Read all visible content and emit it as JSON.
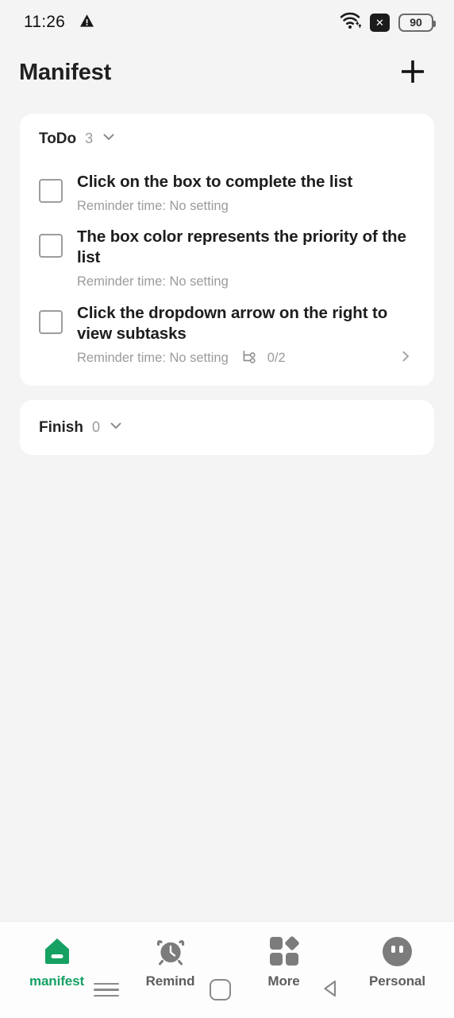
{
  "status_bar": {
    "time": "11:26",
    "warning_icon": "warning-triangle-icon",
    "wifi_icon": "wifi-icon",
    "x_badge_icon": "x-badge-icon",
    "x_badge_label": "✕",
    "battery_level": "90"
  },
  "header": {
    "title": "Manifest",
    "add_icon": "plus-icon"
  },
  "groups": [
    {
      "title": "ToDo",
      "count": "3",
      "chevron_icon": "chevron-down-icon",
      "tasks": [
        {
          "title": "Click on the box to complete the list",
          "reminder": "Reminder time: No setting",
          "checkbox_icon": "checkbox-unchecked-icon",
          "has_subtasks": false
        },
        {
          "title": "The box color represents the priority of the list",
          "reminder": "Reminder time: No setting",
          "checkbox_icon": "checkbox-unchecked-icon",
          "has_subtasks": false
        },
        {
          "title": "Click the dropdown arrow on the right to view subtasks",
          "reminder": "Reminder time: No setting",
          "checkbox_icon": "checkbox-unchecked-icon",
          "has_subtasks": true,
          "subtask_icon": "subtask-tree-icon",
          "subtask_count": "0/2",
          "expand_icon": "chevron-right-icon"
        }
      ]
    },
    {
      "title": "Finish",
      "count": "0",
      "chevron_icon": "chevron-down-icon",
      "tasks": []
    }
  ],
  "bottom_nav": {
    "items": [
      {
        "label": "manifest",
        "icon": "home-manifest-icon",
        "active": true
      },
      {
        "label": "Remind",
        "icon": "alarm-clock-icon",
        "active": false
      },
      {
        "label": "More",
        "icon": "grid-more-icon",
        "active": false
      },
      {
        "label": "Personal",
        "icon": "avatar-face-icon",
        "active": false
      }
    ]
  },
  "system_nav": {
    "recents_icon": "hamburger-recents-icon",
    "home_icon": "square-home-icon",
    "back_icon": "triangle-back-icon"
  },
  "colors": {
    "accent": "#16a163",
    "background": "#f4f4f4",
    "card": "#ffffff",
    "text_primary": "#1d1d1d",
    "text_muted": "#9b9b9b"
  }
}
